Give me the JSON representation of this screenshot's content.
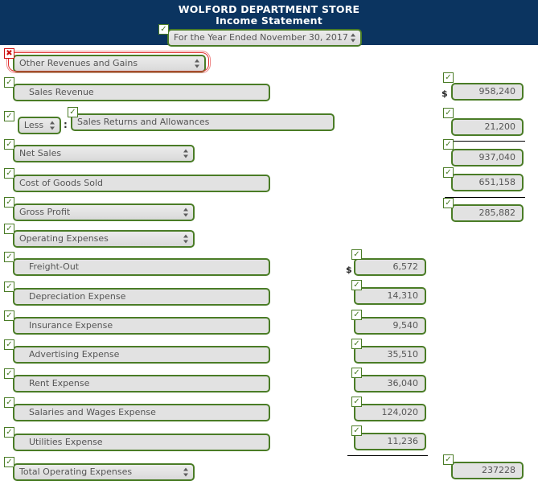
{
  "header": {
    "company": "WOLFORD DEPARTMENT STORE",
    "statement": "Income Statement",
    "period": "For the Year Ended November 30, 2017",
    "period_badge": "✓"
  },
  "symbols": {
    "check": "✓",
    "cross": "✖",
    "dollar": "$",
    "colon": ":"
  },
  "colors": {
    "banner": "#0b3460",
    "field_border": "#4a7c26",
    "field_bg": "#e2e2e2",
    "error": "#e03030",
    "text": "#555555"
  },
  "rows": [
    {
      "id": "other-revenues-and-gains",
      "label": "Other Revenues and Gains",
      "kind": "select",
      "status": "error",
      "badge": "✖"
    },
    {
      "id": "sales-revenue",
      "label": "Sales Revenue",
      "kind": "text",
      "status": "ok",
      "badge": "✓",
      "amount": "958,240",
      "amount_column": "right",
      "amount_badge": "✓",
      "dollar": "$"
    },
    {
      "id": "sales-returns-and-allowances",
      "label": "Sales Returns and Allowances",
      "kind": "text",
      "status": "ok",
      "badge": "✓",
      "prefix_select": "Less",
      "prefix_badge": "✓",
      "amount": "21,200",
      "amount_column": "right",
      "amount_badge": "✓"
    },
    {
      "id": "net-sales",
      "label": "Net Sales",
      "kind": "select",
      "status": "ok",
      "badge": "✓",
      "amount": "937,040",
      "amount_column": "right",
      "amount_badge": "✓",
      "rule_above": true
    },
    {
      "id": "cost-of-goods-sold",
      "label": "Cost of Goods Sold",
      "kind": "text",
      "status": "ok",
      "badge": "✓",
      "amount": "651,158",
      "amount_column": "right",
      "amount_badge": "✓"
    },
    {
      "id": "gross-profit",
      "label": "Gross Profit",
      "kind": "select",
      "status": "ok",
      "badge": "✓",
      "amount": "285,882",
      "amount_column": "right",
      "amount_badge": "✓",
      "rule_above": true
    },
    {
      "id": "operating-expenses",
      "label": "Operating Expenses",
      "kind": "select",
      "status": "ok",
      "badge": "✓"
    },
    {
      "id": "freight-out",
      "label": "Freight-Out",
      "kind": "text",
      "status": "ok",
      "badge": "✓",
      "amount": "6,572",
      "amount_column": "middle",
      "amount_badge": "✓",
      "dollar": "$"
    },
    {
      "id": "depreciation-expense",
      "label": "Depreciation Expense",
      "kind": "text",
      "status": "ok",
      "badge": "✓",
      "amount": "14,310",
      "amount_column": "middle",
      "amount_badge": "✓"
    },
    {
      "id": "insurance-expense",
      "label": "Insurance Expense",
      "kind": "text",
      "status": "ok",
      "badge": "✓",
      "amount": "9,540",
      "amount_column": "middle",
      "amount_badge": "✓"
    },
    {
      "id": "advertising-expense",
      "label": "Advertising Expense",
      "kind": "text",
      "status": "ok",
      "badge": "✓",
      "amount": "35,510",
      "amount_column": "middle",
      "amount_badge": "✓"
    },
    {
      "id": "rent-expense",
      "label": "Rent Expense",
      "kind": "text",
      "status": "ok",
      "badge": "✓",
      "amount": "36,040",
      "amount_column": "middle",
      "amount_badge": "✓"
    },
    {
      "id": "salaries-and-wages-expense",
      "label": "Salaries and Wages Expense",
      "kind": "text",
      "status": "ok",
      "badge": "✓",
      "amount": "124,020",
      "amount_column": "middle",
      "amount_badge": "✓"
    },
    {
      "id": "utilities-expense",
      "label": "Utilities Expense",
      "kind": "text",
      "status": "ok",
      "badge": "✓",
      "amount": "11,236",
      "amount_column": "middle",
      "amount_badge": "✓"
    },
    {
      "id": "total-operating-expenses",
      "label": "Total Operating Expenses",
      "kind": "select",
      "status": "ok",
      "badge": "✓",
      "amount": "237228",
      "amount_column": "right",
      "amount_badge": "✓",
      "rule_above_middle": true
    }
  ]
}
